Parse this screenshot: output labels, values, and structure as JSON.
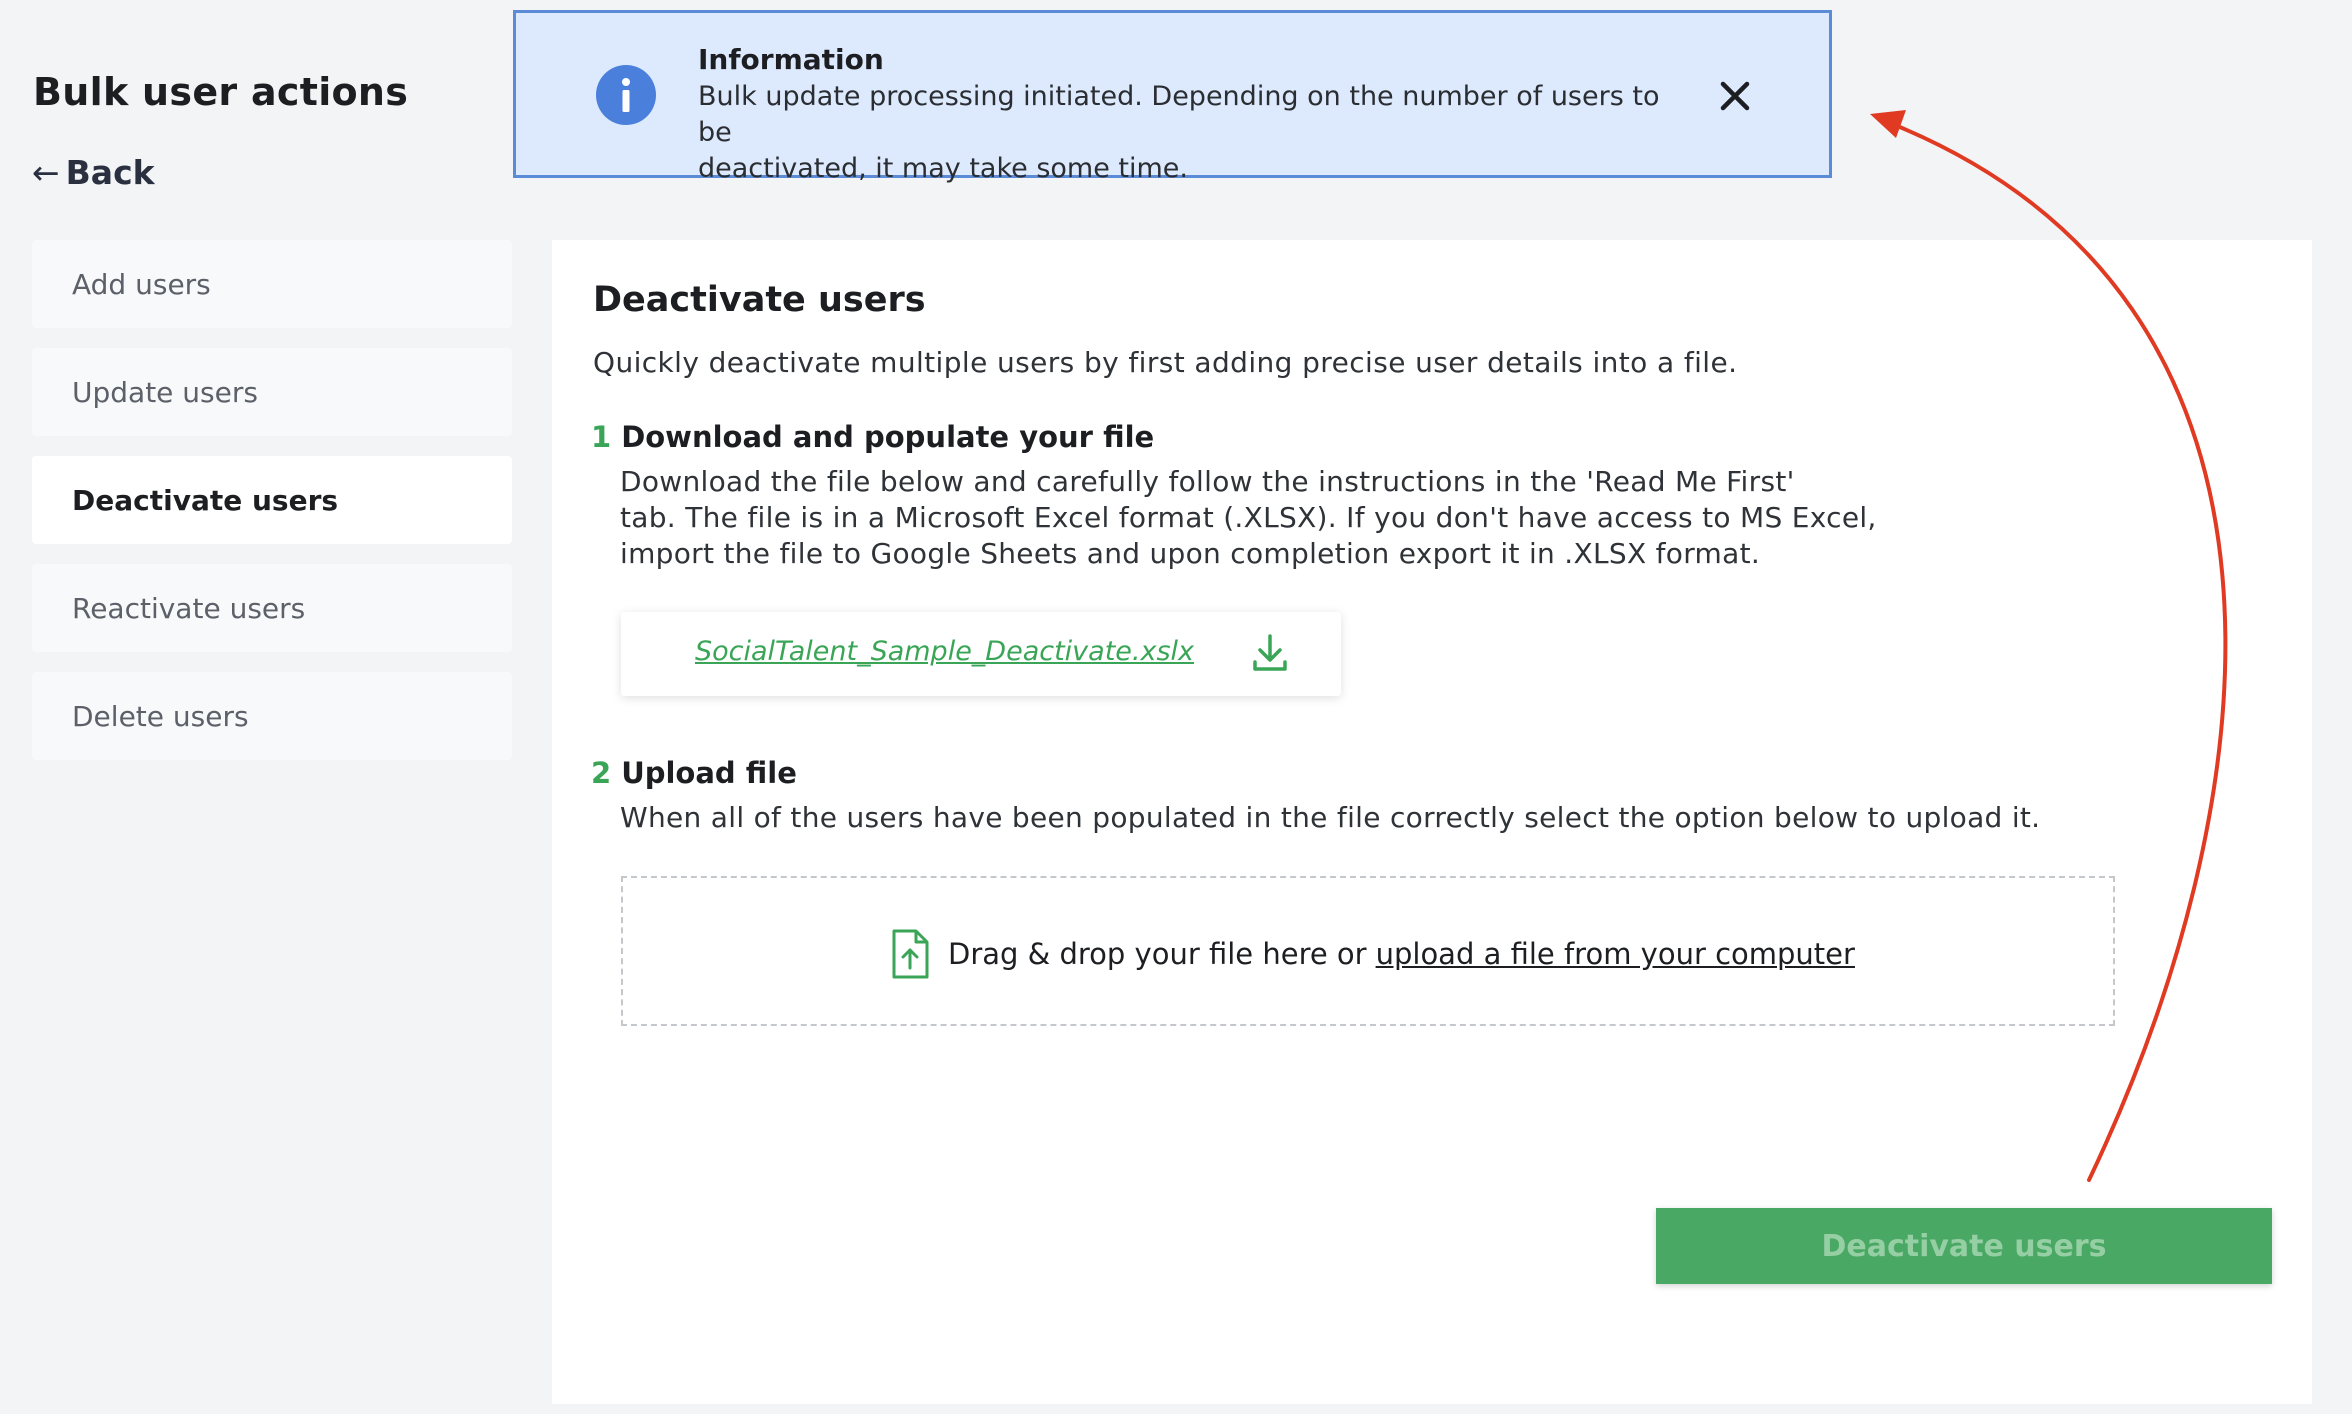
{
  "page": {
    "title": "Bulk user actions",
    "back_label": "Back",
    "back_arrow": "←"
  },
  "sidebar": {
    "items": [
      {
        "label": "Add users",
        "active": false
      },
      {
        "label": "Update users",
        "active": false
      },
      {
        "label": "Deactivate users",
        "active": true
      },
      {
        "label": "Reactivate users",
        "active": false
      },
      {
        "label": "Delete users",
        "active": false
      }
    ]
  },
  "main": {
    "title": "Deactivate users",
    "description": "Quickly deactivate multiple users by first adding precise user details into a file.",
    "step1": {
      "number": "1",
      "heading": "Download and populate your file",
      "body_lines": [
        "Download the file below and carefully follow the instructions in the 'Read Me First'",
        "tab. The file is in a Microsoft Excel format (.XLSX). If you don't have access to MS Excel,",
        "import the file to Google Sheets and upon completion export it in .XLSX format."
      ],
      "file_name": "SocialTalent_Sample_Deactivate.xslx",
      "download_icon": "download-icon"
    },
    "step2": {
      "number": "2",
      "heading": "Upload file",
      "body": "When all of the users have been populated in the file correctly select the option below to upload it.",
      "drop_text": "Drag & drop your file here or",
      "drop_link": "upload a file from your computer",
      "upload_icon": "file-upload-icon"
    },
    "submit_label": "Deactivate users"
  },
  "notification": {
    "title": "Information",
    "message_lines": [
      "Bulk update processing initiated. Depending on the number of users to be",
      "deactivated, it may take some time."
    ],
    "icon": "info-icon",
    "close_icon": "close-icon"
  },
  "colors": {
    "accent_green": "#3aa556",
    "button_green": "#4aa865",
    "info_blue": "#5b8ad6",
    "info_bg": "#dde9fd",
    "annotation_red": "#e03a22"
  }
}
